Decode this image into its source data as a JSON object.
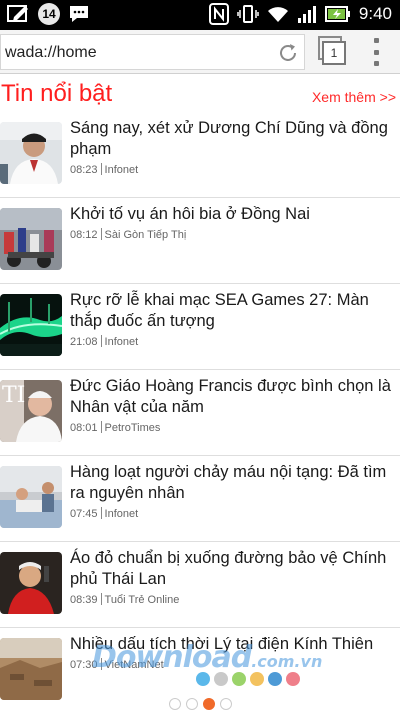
{
  "status_bar": {
    "notification_count": "14",
    "time": "9:40"
  },
  "browser": {
    "url": "wada://home",
    "tab_count": "1"
  },
  "section": {
    "title": "Tin nổi bật",
    "see_more": "Xem thêm >>"
  },
  "news": [
    {
      "title": "Sáng nay, xét xử Dương Chí Dũng và đồng phạm",
      "time": "08:23",
      "source": "Infonet"
    },
    {
      "title": "Khởi tố vụ án hôi bia ở Đồng Nai",
      "time": "08:12",
      "source": "Sài Gòn Tiếp Thị"
    },
    {
      "title": "Rực rỡ lễ khai mạc SEA Games 27: Màn thắp đuốc ấn tượng",
      "time": "21:08",
      "source": "Infonet"
    },
    {
      "title": "Đức Giáo Hoàng Francis được bình chọn là Nhân vật của năm",
      "time": "08:01",
      "source": "PetroTimes"
    },
    {
      "title": "Hàng loạt người chảy máu nội tạng: Đã tìm ra nguyên nhân",
      "time": "07:45",
      "source": "Infonet"
    },
    {
      "title": "Áo đỏ chuẩn bị xuống đường bảo vệ Chính phủ Thái Lan",
      "time": "08:39",
      "source": "Tuổi Trẻ Online"
    },
    {
      "title": "Nhiều dấu tích thời Lý tại điện Kính Thiên",
      "time": "07:30",
      "source": "VietNamNet"
    }
  ],
  "watermark": {
    "text": "Download",
    "suffix": ".com.vn"
  },
  "colors": {
    "accent_red": "#ff1e1e",
    "pager_active": "#f06a2a"
  }
}
